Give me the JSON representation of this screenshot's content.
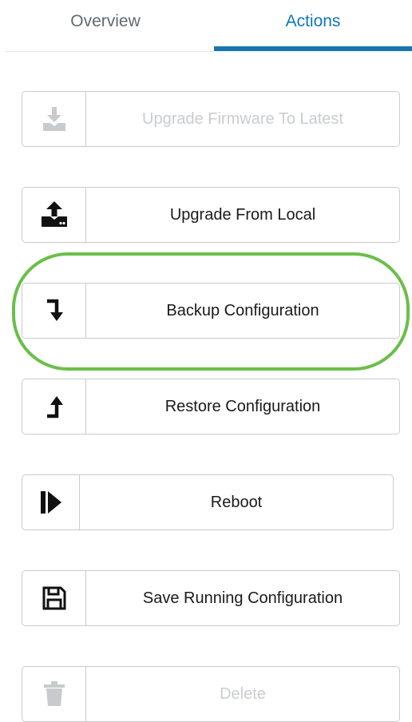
{
  "tabs": {
    "overview": "Overview",
    "actions": "Actions",
    "active": "actions"
  },
  "colors": {
    "accent": "#1a74ad",
    "highlight": "#6bbf48",
    "disabled_text": "#c9cdd0"
  },
  "actions": [
    {
      "label": "Upgrade Firmware To Latest",
      "icon": "download-tray-icon",
      "enabled": false
    },
    {
      "label": "Upgrade From Local",
      "icon": "upload-tray-icon",
      "enabled": true
    },
    {
      "label": "Backup Configuration",
      "icon": "arrow-down-turn-icon",
      "enabled": true,
      "highlighted": true
    },
    {
      "label": "Restore Configuration",
      "icon": "arrow-up-turn-icon",
      "enabled": true
    },
    {
      "label": "Reboot",
      "icon": "play-bar-icon",
      "enabled": true
    },
    {
      "label": "Save Running Configuration",
      "icon": "floppy-disk-icon",
      "enabled": true
    },
    {
      "label": "Delete",
      "icon": "trash-icon",
      "enabled": false
    }
  ]
}
